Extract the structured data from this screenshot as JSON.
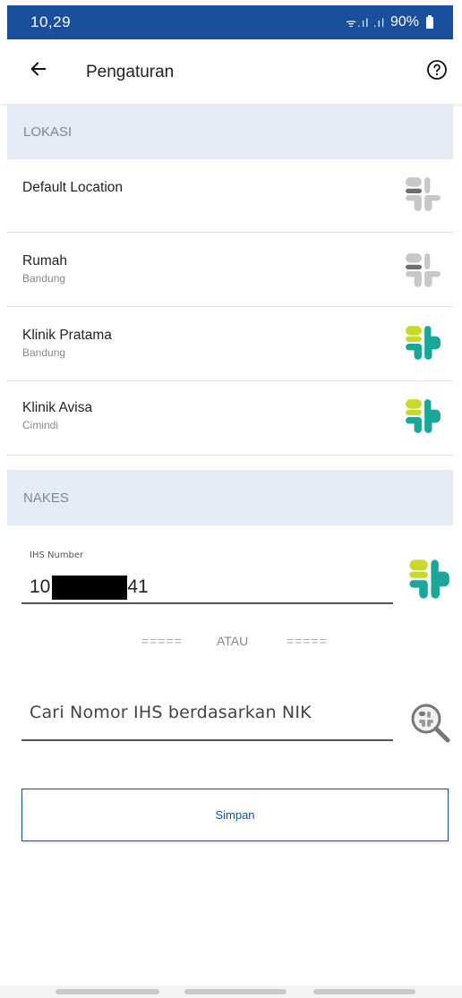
{
  "status_bar": {
    "time": "10,29",
    "signal_icons": "ᯤ.ıl .ıl",
    "battery": "90%",
    "bg_color": "#1a4f9c"
  },
  "header": {
    "back_icon": "arrow-left-icon",
    "title": "Pengaturan",
    "help_icon": "question-circle-icon"
  },
  "lokasi": {
    "section_title": "LOKASI",
    "items": [
      {
        "name": "Default Location",
        "sub": "",
        "logo_color": "gray"
      },
      {
        "name": "Rumah",
        "sub": "Bandung",
        "logo_color": "gray"
      },
      {
        "name": "Klinik Pratama",
        "sub": "Bandung",
        "logo_color": "green-teal"
      },
      {
        "name": "Klinik Avisa",
        "sub": "Cimindi",
        "logo_color": "green-teal"
      }
    ]
  },
  "nakes": {
    "section_title": "NAKES",
    "ihs_label": "IHS Number",
    "ihs_value_start": "10",
    "ihs_value_end": "41",
    "divider_left": "=====",
    "divider_text": "ATAU",
    "divider_right": "=====",
    "nik_placeholder": "Cari Nomor IHS berdasarkan NIK"
  },
  "save_button": {
    "label": "Simpan"
  },
  "colors": {
    "primary": "#1a4f9c",
    "section_bg": "#e4ebf4",
    "logo_gray_light": "#c8c8c8",
    "logo_gray_dark": "#6e6e6e",
    "logo_lime": "#c8d92a",
    "logo_teal": "#1aa79a"
  }
}
